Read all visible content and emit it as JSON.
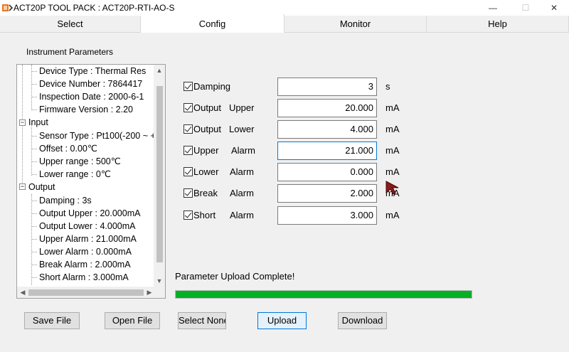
{
  "window": {
    "title": "ACT20P TOOL PACK : ACT20P-RTI-AO-S",
    "min_glyph": "—",
    "max_glyph": "☐",
    "close_glyph": "✕"
  },
  "tabs": [
    {
      "label": "Select",
      "active": false
    },
    {
      "label": "Config",
      "active": true
    },
    {
      "label": "Monitor",
      "active": false
    },
    {
      "label": "Help",
      "active": false
    }
  ],
  "config": {
    "section_label": "Instrument Parameters",
    "tree": {
      "info_items": [
        "Device Type : Thermal Res",
        "Device Number : 7864417",
        "Inspection Date : 2000-6-1",
        "Firmware Version : 2.20"
      ],
      "input_root": "Input",
      "input_items": [
        "Sensor Type : Pt100(-200 ~ +",
        "Offset : 0.00℃",
        "Upper range : 500℃",
        "Lower range : 0℃"
      ],
      "output_root": "Output",
      "output_items": [
        "Damping : 3s",
        "Output   Upper : 20.000mA",
        "Output   Lower : 4.000mA",
        "Upper     Alarm : 21.000mA",
        "Lower     Alarm : 0.000mA",
        "Break      Alarm : 2.000mA",
        "Short      Alarm : 3.000mA"
      ]
    },
    "params": [
      {
        "label": "Damping",
        "label2": "",
        "value": "3",
        "unit": "s",
        "checked": true
      },
      {
        "label": "Output",
        "label2": "Upper",
        "value": "20.000",
        "unit": "mA",
        "checked": true
      },
      {
        "label": "Output",
        "label2": "Lower",
        "value": "4.000",
        "unit": "mA",
        "checked": true
      },
      {
        "label": "Upper",
        "label2": "Alarm",
        "value": "21.000",
        "unit": "mA",
        "checked": true
      },
      {
        "label": "Lower",
        "label2": "Alarm",
        "value": "0.000",
        "unit": "mA",
        "checked": true
      },
      {
        "label": "Break",
        "label2": "Alarm",
        "value": "2.000",
        "unit": "mA",
        "checked": true
      },
      {
        "label": "Short",
        "label2": "Alarm",
        "value": "3.000",
        "unit": "mA",
        "checked": true
      }
    ],
    "status": "Parameter Upload Complete!",
    "progress_fraction": 1.0,
    "buttons": {
      "save": "Save File",
      "open": "Open File",
      "select_none": "Select None",
      "upload": "Upload",
      "download": "Download"
    }
  },
  "colors": {
    "progress": "#06b025",
    "focus_border": "#0078d7",
    "cursor": "#8b1a1a"
  }
}
